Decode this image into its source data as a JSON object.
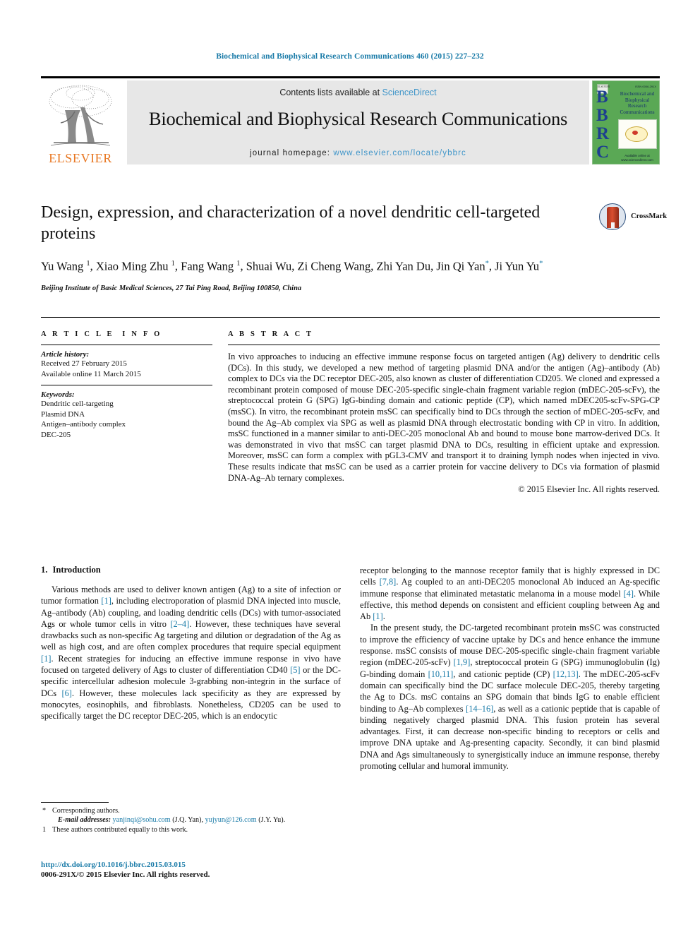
{
  "running_head": "Biochemical and Biophysical Research Communications 460 (2015) 227–232",
  "masthead": {
    "publisher": "ELSEVIER",
    "contents_prefix": "Contents lists available at ",
    "contents_link": "ScienceDirect",
    "journal_name": "Biochemical and Biophysical Research Communications",
    "homepage_prefix": "journal homepage: ",
    "homepage_url": "www.elsevier.com/locate/ybbrc",
    "cover": {
      "letters": "BBRC",
      "title": "Biochemical and Biophysical Research Communications",
      "publisher_mark": "ELSEVIER",
      "issn_mark": "ISSN 0006-291X",
      "footer": "Available online at www.sciencedirect.com"
    }
  },
  "article": {
    "title": "Design, expression, and characterization of a novel dendritic cell-targeted proteins",
    "authors_line_1": "Yu Wang",
    "authors_full": "Yu Wang 1, Xiao Ming Zhu 1, Fang Wang 1, Shuai Wu, Zi Cheng Wang, Zhi Yan Du, Jin Qi Yan *, Ji Yun Yu *",
    "affiliation": "Beijing Institute of Basic Medical Sciences, 27 Tai Ping Road, Beijing 100850, China",
    "crossmark_label": "CrossMark"
  },
  "article_info": {
    "heading": "ARTICLE INFO",
    "history_label": "Article history:",
    "history_lines": [
      "Received 27 February 2015",
      "Available online 11 March 2015"
    ],
    "keywords_label": "Keywords:",
    "keywords": [
      "Dendritic cell-targeting",
      "Plasmid DNA",
      "Antigen–antibody complex",
      "DEC-205"
    ]
  },
  "abstract": {
    "heading": "ABSTRACT",
    "text": "In vivo approaches to inducing an effective immune response focus on targeted antigen (Ag) delivery to dendritic cells (DCs). In this study, we developed a new method of targeting plasmid DNA and/or the antigen (Ag)–antibody (Ab) complex to DCs via the DC receptor DEC-205, also known as cluster of differentiation CD205. We cloned and expressed a recombinant protein composed of mouse DEC-205-specific single-chain fragment variable region (mDEC-205-scFv), the streptococcal protein G (SPG) IgG-binding domain and cationic peptide (CP), which named mDEC205-scFv-SPG-CP (msSC). In vitro, the recombinant protein msSC can specifically bind to DCs through the section of mDEC-205-scFv, and bound the Ag–Ab complex via SPG as well as plasmid DNA through electrostatic bonding with CP in vitro. In addition, msSC functioned in a manner similar to anti-DEC-205 monoclonal Ab and bound to mouse bone marrow-derived DCs. It was demonstrated in vivo that msSC can target plasmid DNA to DCs, resulting in efficient uptake and expression. Moreover, msSC can form a complex with pGL3-CMV and transport it to draining lymph nodes when injected in vivo. These results indicate that msSC can be used as a carrier protein for vaccine delivery to DCs via formation of plasmid DNA-Ag–Ab ternary complexes.",
    "copyright": "© 2015 Elsevier Inc. All rights reserved."
  },
  "introduction": {
    "section_number": "1.",
    "section_title": "Introduction",
    "paragraph_1_parts": [
      "Various methods are used to deliver known antigen (Ag) to a site of infection or tumor formation ",
      "[1]",
      ", including electroporation of plasmid DNA injected into muscle, Ag–antibody (Ab) coupling, and loading dendritic cells (DCs) with tumor-associated Ags or whole tumor cells in vitro ",
      "[2–4]",
      ". However, these techniques have several drawbacks such as non-specific Ag targeting and dilution or degradation of the Ag as well as high cost, and are often complex procedures that require special equipment ",
      "[1]",
      ". Recent strategies for inducing an effective immune response in vivo have focused on targeted delivery of Ags to cluster of differentiation CD40 ",
      "[5]",
      " or the DC-specific intercellular adhesion molecule 3-grabbing non-integrin in the surface of DCs ",
      "[6]",
      ". However, these molecules lack specificity as they are expressed by monocytes, eosinophils, and fibroblasts. Nonetheless, CD205 can be used to specifically target the DC receptor DEC-205, which is an endocytic receptor belonging to the mannose receptor family that is highly expressed in DC cells ",
      "[7,8]",
      ". Ag coupled to an anti-DEC205 monoclonal Ab induced an Ag-specific immune response that eliminated metastatic melanoma in a mouse model ",
      "[4]",
      ". While effective, this method depends on consistent and efficient coupling between Ag and Ab ",
      "[1]",
      "."
    ],
    "paragraph_2_parts": [
      "In the present study, the DC-targeted recombinant protein msSC was constructed to improve the efficiency of vaccine uptake by DCs and hence enhance the immune response. msSC consists of mouse DEC-205-specific single-chain fragment variable region (mDEC-205-scFv) ",
      "[1,9]",
      ", streptococcal protein G (SPG) immunoglobulin (Ig) G-binding domain ",
      "[10,11]",
      ", and cationic peptide (CP) ",
      "[12,13]",
      ". The mDEC-205-scFv domain can specifically bind the DC surface molecule DEC-205, thereby targeting the Ag to DCs. msC contains an SPG domain that binds IgG to enable efficient binding to Ag–Ab complexes ",
      "[14–16]",
      ", as well as a cationic peptide that is capable of binding negatively charged plasmid DNA. This fusion protein has several advantages. First, it can decrease non-specific binding to receptors or cells and improve DNA uptake and Ag-presenting capacity. Secondly, it can bind plasmid DNA and Ags simultaneously to synergistically induce an immune response, thereby promoting cellular and humoral immunity."
    ]
  },
  "footnotes": {
    "corresponding_mark": "*",
    "corresponding_text": "Corresponding authors.",
    "email_label": "E-mail addresses:",
    "email_1": "yanjinqi@sohu.com",
    "email_1_owner": "(J.Q. Yan),",
    "email_2": "yujyun@126.com",
    "email_2_owner": "(J.Y. Yu).",
    "equal_mark": "1",
    "equal_text": "These authors contributed equally to this work."
  },
  "footer": {
    "doi": "http://dx.doi.org/10.1016/j.bbrc.2015.03.015",
    "issn_copyright": "0006-291X/© 2015 Elsevier Inc. All rights reserved."
  },
  "colors": {
    "link_blue": "#1a7ba8",
    "sciencedirect_blue": "#3f95c9",
    "elsevier_orange": "#E87722",
    "cover_green": "#5aa855",
    "band_gray": "#e7e7e7"
  }
}
